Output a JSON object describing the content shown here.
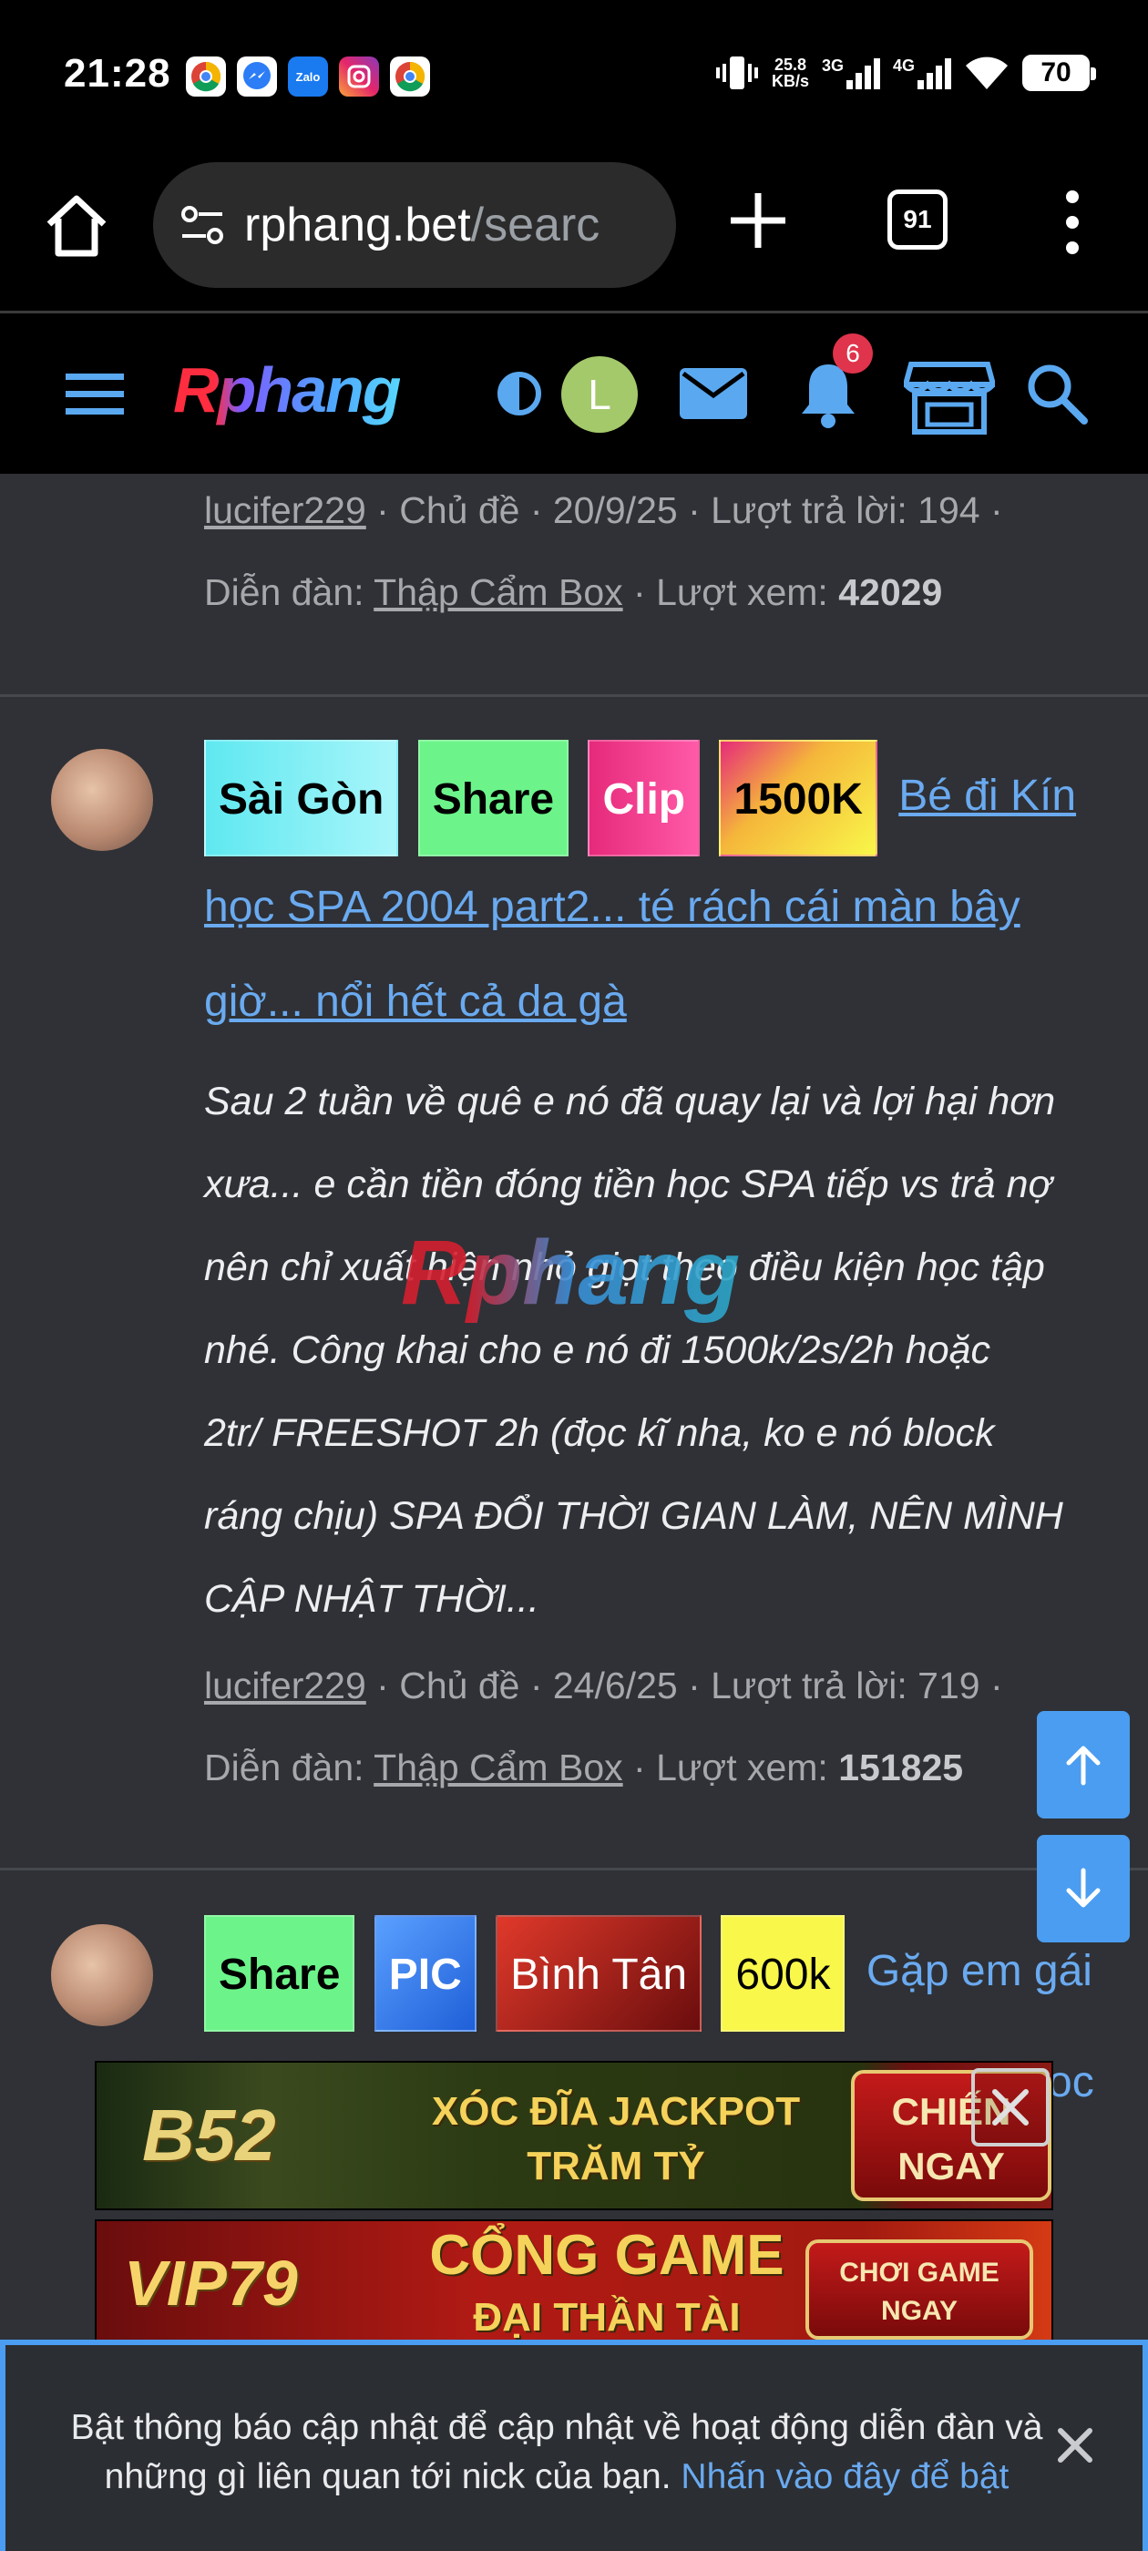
{
  "status_bar": {
    "time": "21:28",
    "apps": [
      "chrome",
      "messenger",
      "Zalo",
      "instagram",
      "chrome"
    ],
    "net_speed_value": "25.8",
    "net_speed_unit": "KB/s",
    "signal1_label": "3G",
    "signal2_label": "4G",
    "battery": "70"
  },
  "browser": {
    "url_host": "rphang.bet",
    "url_path": "/searc",
    "tab_count": "91"
  },
  "site_header": {
    "logo": "Rphang",
    "avatar_letter": "L",
    "notification_count": "6"
  },
  "thread0": {
    "author": "lucifer229",
    "type_label": "Chủ đề",
    "date": "20/9/25",
    "replies_label": "Lượt trả lời:",
    "replies": "194",
    "forum_label": "Diễn đàn:",
    "forum": "Thập Cẩm Box",
    "views_label": "Lượt xem:",
    "views": "42029"
  },
  "thread1": {
    "prefixes": [
      "Sài Gòn",
      "Share",
      "Clip",
      "1500K"
    ],
    "title_line1": "Bé đi Kín",
    "title_line2": "học SPA 2004 part2... té rách cái màn bây",
    "title_line3": "giờ... nổi hết cả da gà",
    "snippet_lines": [
      "Sau 2 tuần về quê e nó đã quay lại và lợi hại hơn",
      "xưa... e cần tiền đóng tiền học SPA tiếp vs trả nợ",
      "nên chỉ xuất hiện nhỏ giọt theo điều kiện học tập",
      "nhé. Công khai cho e nó đi 1500k/2s/2h hoặc",
      "2tr/ FREESHOT 2h (đọc kĩ nha, ko e nó block",
      "ráng chịu) SPA ĐỔI THỜI GIAN LÀM, NÊN MÌNH",
      "CẬP NHẬT THỜI..."
    ],
    "author": "lucifer229",
    "type_label": "Chủ đề",
    "date": "24/6/25",
    "replies_label": "Lượt trả lời:",
    "replies": "719",
    "forum_label": "Diễn đàn:",
    "forum": "Thập Cẩm Box",
    "views_label": "Lượt xem:",
    "views": "151825"
  },
  "thread2": {
    "prefixes": [
      "Share",
      "PIC",
      "Bình Tân",
      "600k"
    ],
    "title_line1": "Gặp em gái",
    "title_line2_tail": "oc"
  },
  "watermark": "Rphang",
  "ads": {
    "b52_logo": "B52",
    "b52_line1": "XÓC ĐĨA JACKPOT",
    "b52_line2": "TRĂM TỶ",
    "b52_cta_line1": "CHIẾN",
    "b52_cta_line2": "NGAY",
    "vip_logo": "VIP79",
    "vip_line1": "CỔNG GAME",
    "vip_line2": "ĐẠI THẦN TÀI",
    "vip_cta_line1": "CHƠI GAME",
    "vip_cta_line2": "NGAY"
  },
  "notice": {
    "text": "Bật thông báo cập nhật để cập nhật về hoạt động diễn đàn và những gì liên quan tới nick của bạn.",
    "link": "Nhấn vào đây để bật"
  },
  "colors": {
    "link": "#6aaaf0",
    "accent": "#4a9df0",
    "background": "#2f3136",
    "prefix_saigon": "#8ff2f6",
    "prefix_share": "#6cf48a",
    "prefix_clip": "#f03c8c",
    "prefix_1500k": "#f5b63a",
    "prefix_pic": "#2f7bf2",
    "prefix_binhtan": "#c4251f",
    "prefix_600k": "#f9f74a"
  }
}
